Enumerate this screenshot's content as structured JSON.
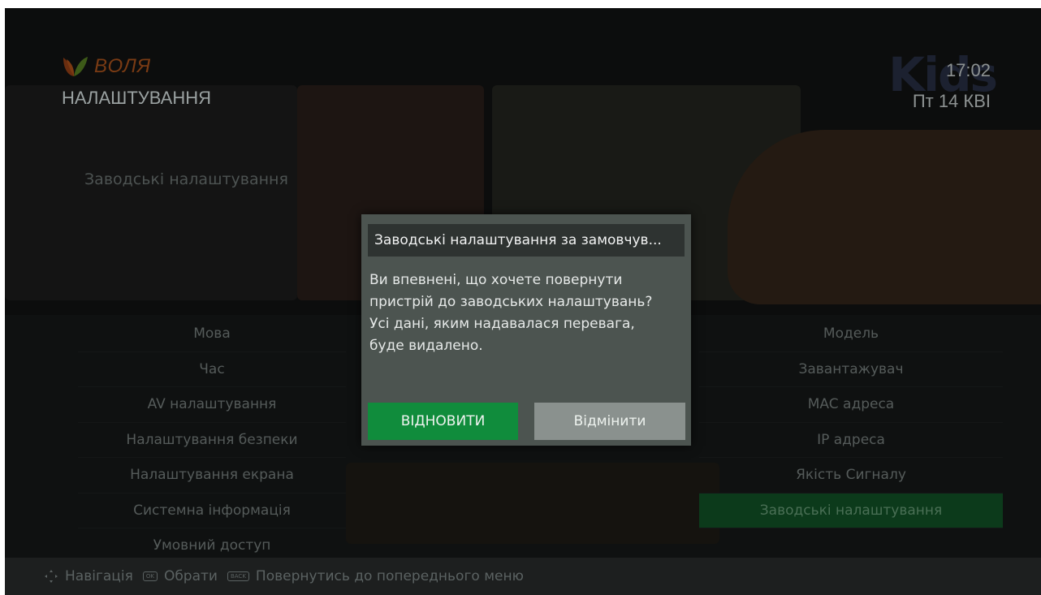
{
  "header": {
    "brand": "ВОЛЯ",
    "title": "НАЛАШТУВАННЯ",
    "time": "17:02",
    "date": "Пт 14 КВІ",
    "channel_logo": "Kids"
  },
  "section_title": "Заводські налаштування",
  "left_menu": [
    "Мова",
    "Час",
    "AV налаштування",
    "Налаштування безпеки",
    "Налаштування екрана",
    "Системна інформація",
    "Умовний доступ"
  ],
  "right_menu": [
    "Модель",
    "Завантажувач",
    "MAC адреса",
    "IP адреса",
    "Якість Сигналу",
    "Заводські налаштування"
  ],
  "right_menu_active_index": 5,
  "dialog": {
    "title": "Заводські налаштування за замовчув...",
    "message": "Ви впевнені, що хочете повернути пристрій до заводських налаштувань? Усі дані, яким надавалася перевага, буде видалено.",
    "restore_label": "ВІДНОВИТИ",
    "cancel_label": "Відмінити"
  },
  "footer": {
    "navigation_label": "Навігація",
    "ok_key": "OK",
    "select_label": "Обрати",
    "back_key": "BACK",
    "back_label": "Повернутись до попереднього меню"
  },
  "colors": {
    "accent_green": "#108c3c",
    "dialog_bg": "#4c5450",
    "brand_orange": "#7a3b14"
  },
  "icons": {
    "logo": "leaf-logo-icon",
    "navigation": "dpad-navigation-icon"
  }
}
